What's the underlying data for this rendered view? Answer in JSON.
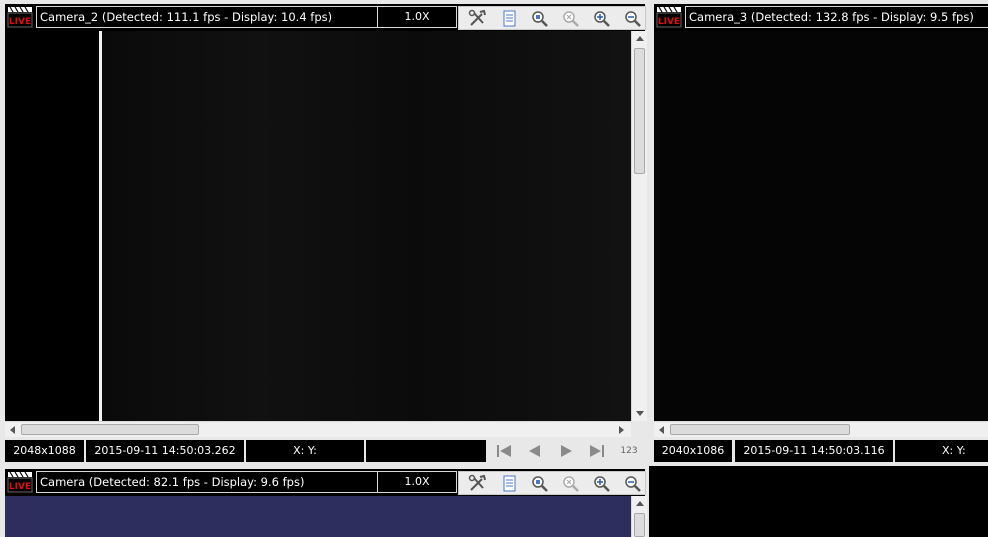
{
  "panels": {
    "cam2": {
      "title": "Camera_2  (Detected: 111.1 fps - Display: 10.4 fps)",
      "zoom": "1.0X",
      "resolution": "2048x1088",
      "timestamp": "2015-09-11 14:50:03.262",
      "coords": "X: Y:",
      "frame_counter_label": "123"
    },
    "cam3": {
      "title": "Camera_3  (Detected: 132.8 fps - Display: 9.5 fps)",
      "resolution": "2040x1086",
      "timestamp": "2015-09-11 14:50:03.116",
      "coords": "X: Y:"
    },
    "cam1": {
      "title": "Camera  (Detected: 82.1 fps - Display: 9.6 fps)",
      "zoom": "1.0X"
    }
  },
  "icons": {
    "live_badge": "live-icon",
    "toolbar": [
      "tools-icon",
      "document-icon",
      "zoom-fit-icon",
      "zoom-reset-icon",
      "zoom-in-icon",
      "zoom-out-icon"
    ],
    "playback": [
      "skip-to-start-icon",
      "step-back-icon",
      "play-icon",
      "skip-to-end-icon"
    ]
  },
  "colors": {
    "live_red": "#e01010",
    "cam1_view": "#2e2e5e",
    "panel_frame": "#e8e8e8"
  }
}
